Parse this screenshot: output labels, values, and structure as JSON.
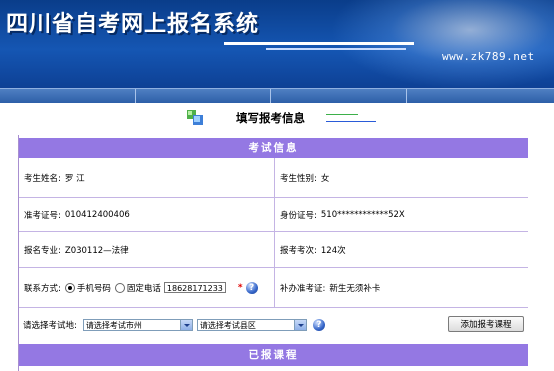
{
  "banner": {
    "title": "四川省自考网上报名系统",
    "url": "www.zk789.net"
  },
  "heading": {
    "title": "填写报考信息"
  },
  "exam_section": {
    "title": "考试信息"
  },
  "fields": {
    "name_label": "考生姓名:",
    "name_value": "罗 江",
    "gender_label": "考生性别:",
    "gender_value": "女",
    "ticket_label": "准考证号:",
    "ticket_value": "010412400406",
    "id_label": "身份证号:",
    "id_value": "510************52X",
    "major_label": "报名专业:",
    "major_value": "Z030112—法律",
    "count_label": "报考考次:",
    "count_value": "124次",
    "contact_label": "联系方式:",
    "mobile_label": "手机号码",
    "landline_label": "固定电话",
    "phone_value": "18628171233",
    "required_mark": "*",
    "help_glyph": "?",
    "reissue_label": "补办准考证:",
    "reissue_value": "新生无须补卡"
  },
  "location": {
    "label": "请选择考试地:",
    "city_select": "请选择考试市州",
    "county_select": "请选择考试县区",
    "add_button": "添加报考课程"
  },
  "courses_section": {
    "title": "已报课程"
  },
  "colors": {
    "banner": "#1556b3",
    "section_bar": "#9478e3",
    "required": "#e00000"
  },
  "icons": {
    "heading": "form-icon",
    "help": "question-icon"
  }
}
